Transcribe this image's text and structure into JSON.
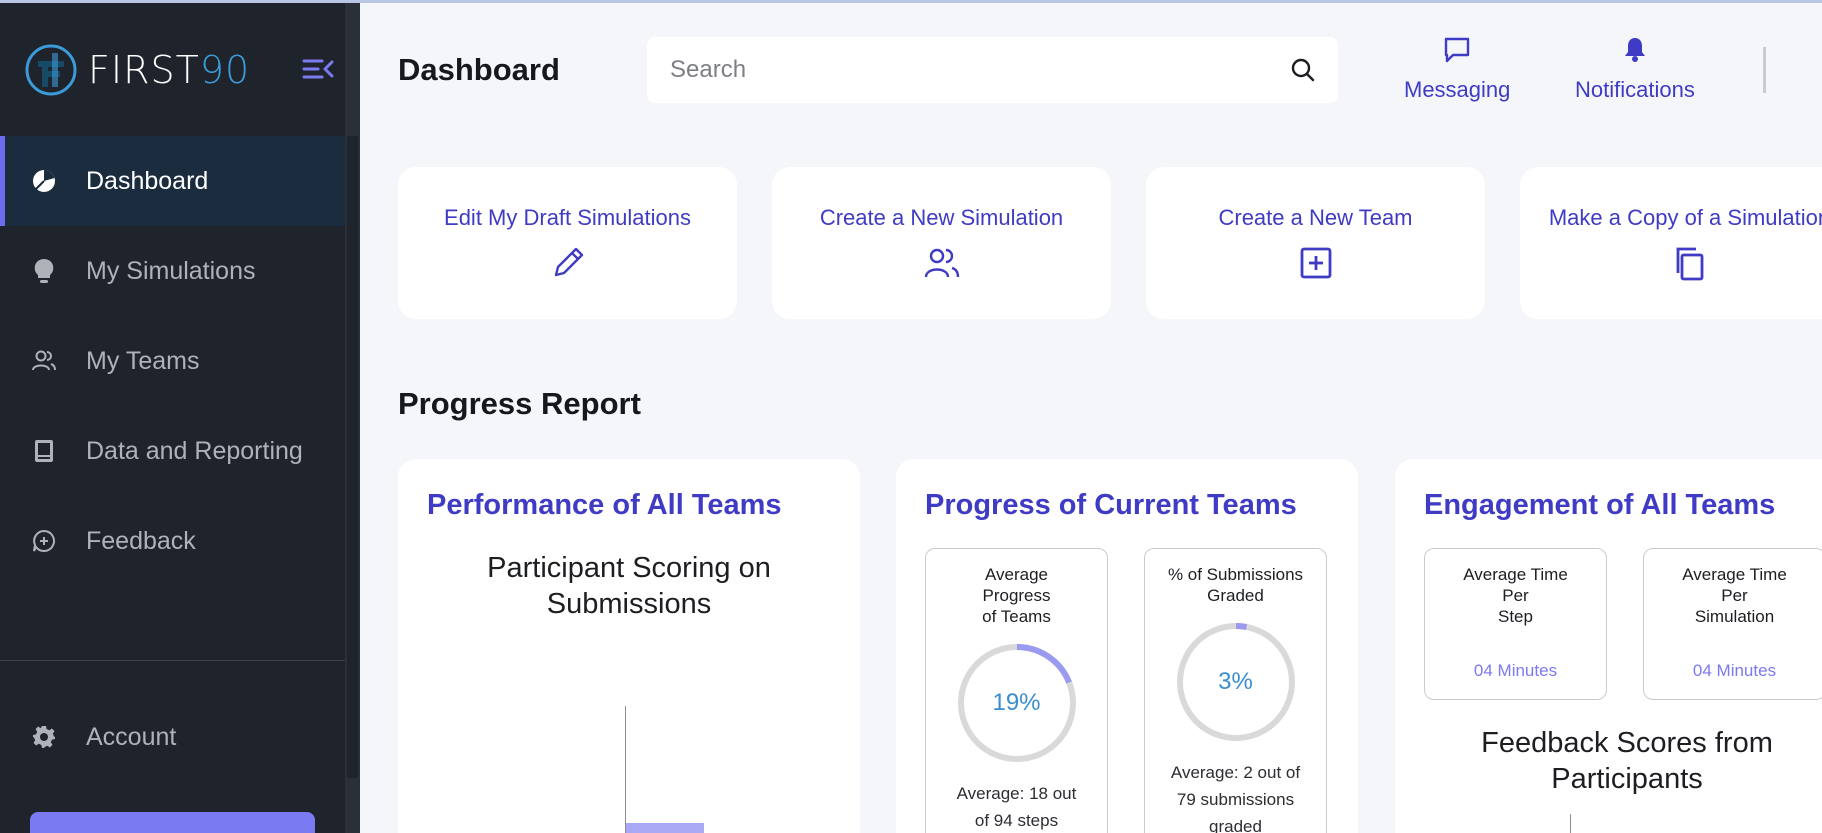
{
  "brand": {
    "name_part1": "FIRST",
    "name_part2": "90",
    "accent": "#3a9bd8"
  },
  "sidebar": {
    "items": [
      {
        "label": "Dashboard",
        "icon": "pie-chart-icon",
        "active": true
      },
      {
        "label": "My Simulations",
        "icon": "lightbulb-icon",
        "active": false
      },
      {
        "label": "My Teams",
        "icon": "users-icon",
        "active": false
      },
      {
        "label": "Data and Reporting",
        "icon": "book-icon",
        "active": false
      },
      {
        "label": "Feedback",
        "icon": "feedback-icon",
        "active": false
      }
    ],
    "account_label": "Account"
  },
  "header": {
    "title": "Dashboard",
    "search_placeholder": "Search",
    "messaging_label": "Messaging",
    "notifications_label": "Notifications"
  },
  "quick_actions": [
    {
      "label": "Edit My Draft Simulations",
      "icon": "pencil-icon"
    },
    {
      "label": "Create a New Simulation",
      "icon": "users-icon"
    },
    {
      "label": "Create a New Team",
      "icon": "plus-square-icon"
    },
    {
      "label": "Make a Copy of a Simulation",
      "icon": "copy-icon"
    }
  ],
  "progress_report": {
    "section_title": "Progress Report",
    "performance": {
      "title": "Performance of All Teams",
      "chart_title_line1": "Participant Scoring on",
      "chart_title_line2": "Submissions"
    },
    "progress": {
      "title": "Progress of Current Teams",
      "avg_progress": {
        "title_line1": "Average",
        "title_line2": "Progress",
        "title_line3": "of Teams",
        "percent": 19,
        "percent_label": "19%",
        "foot_line1": "Average: 18 out",
        "foot_line2": "of 94 steps"
      },
      "submissions_graded": {
        "title_line1": "% of Submissions",
        "title_line2": "Graded",
        "percent": 3,
        "percent_label": "3%",
        "foot_line1": "Average: 2 out of",
        "foot_line2": "79 submissions",
        "foot_line3": "graded"
      }
    },
    "engagement": {
      "title": "Engagement of All Teams",
      "per_step": {
        "title_line1": "Average Time",
        "title_line2": "Per",
        "title_line3": "Step",
        "value": "04 Minutes"
      },
      "per_simulation": {
        "title_line1": "Average Time",
        "title_line2": "Per",
        "title_line3": "Simulation",
        "value": "04 Minutes"
      },
      "chart_title_line1": "Feedback Scores from",
      "chart_title_line2": "Participants"
    }
  },
  "colors": {
    "primary": "#3f3bc4",
    "ring_track": "#d9d9d9",
    "ring_fill": "#9a9af0",
    "sidebar_bg": "#1f232b"
  }
}
